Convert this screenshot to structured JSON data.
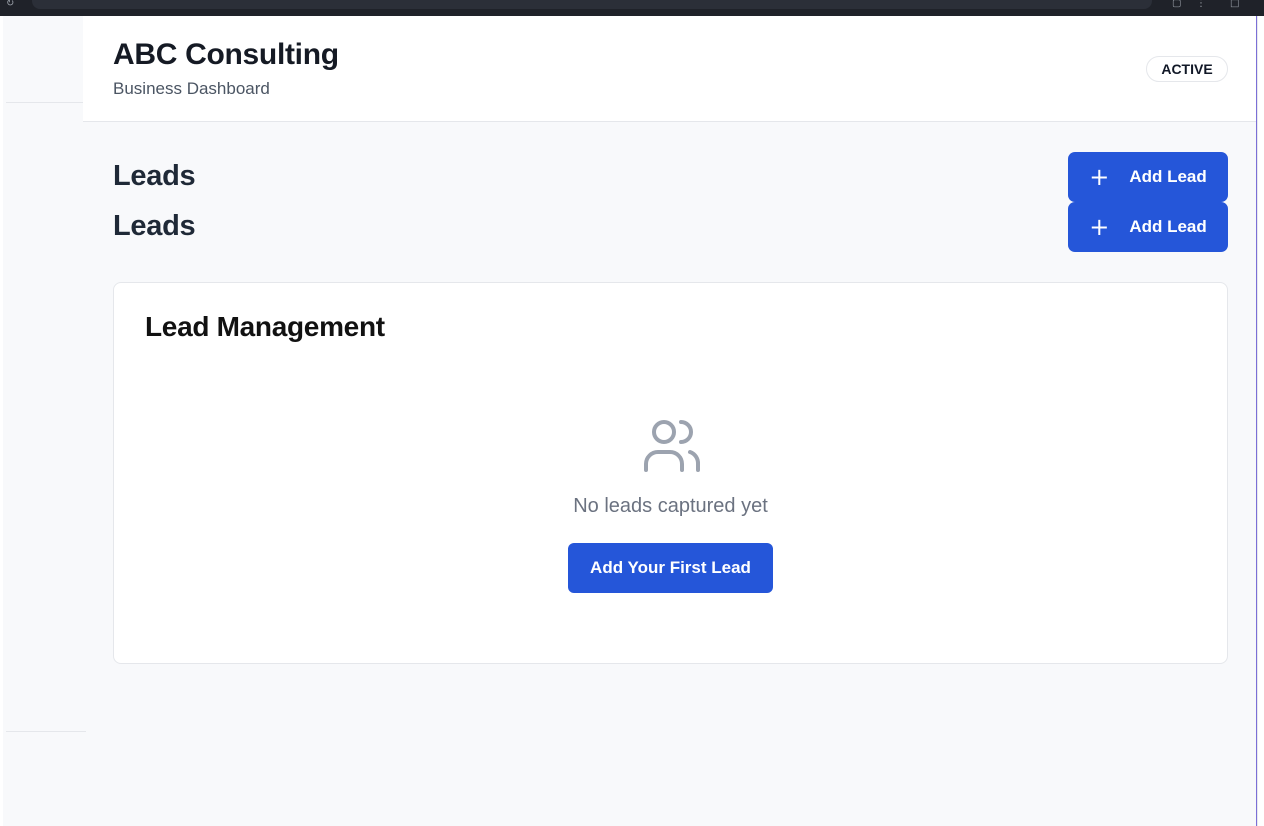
{
  "colors": {
    "accent": "#2556d9",
    "page_background": "#f8f9fb",
    "text_primary": "#1f2937",
    "text_muted": "#6b7280"
  },
  "header": {
    "company_name": "ABC Consulting",
    "subtitle": "Business Dashboard",
    "status_badge": "ACTIVE"
  },
  "sections": [
    {
      "title": "Leads",
      "add_button_label": "Add Lead",
      "add_button_icon": "plus-icon"
    },
    {
      "title": "Leads",
      "add_button_label": "Add Lead",
      "add_button_icon": "plus-icon"
    }
  ],
  "card": {
    "title": "Lead Management",
    "empty_state": {
      "icon": "users-icon",
      "message": "No leads captured yet",
      "button_label": "Add Your First Lead"
    }
  }
}
